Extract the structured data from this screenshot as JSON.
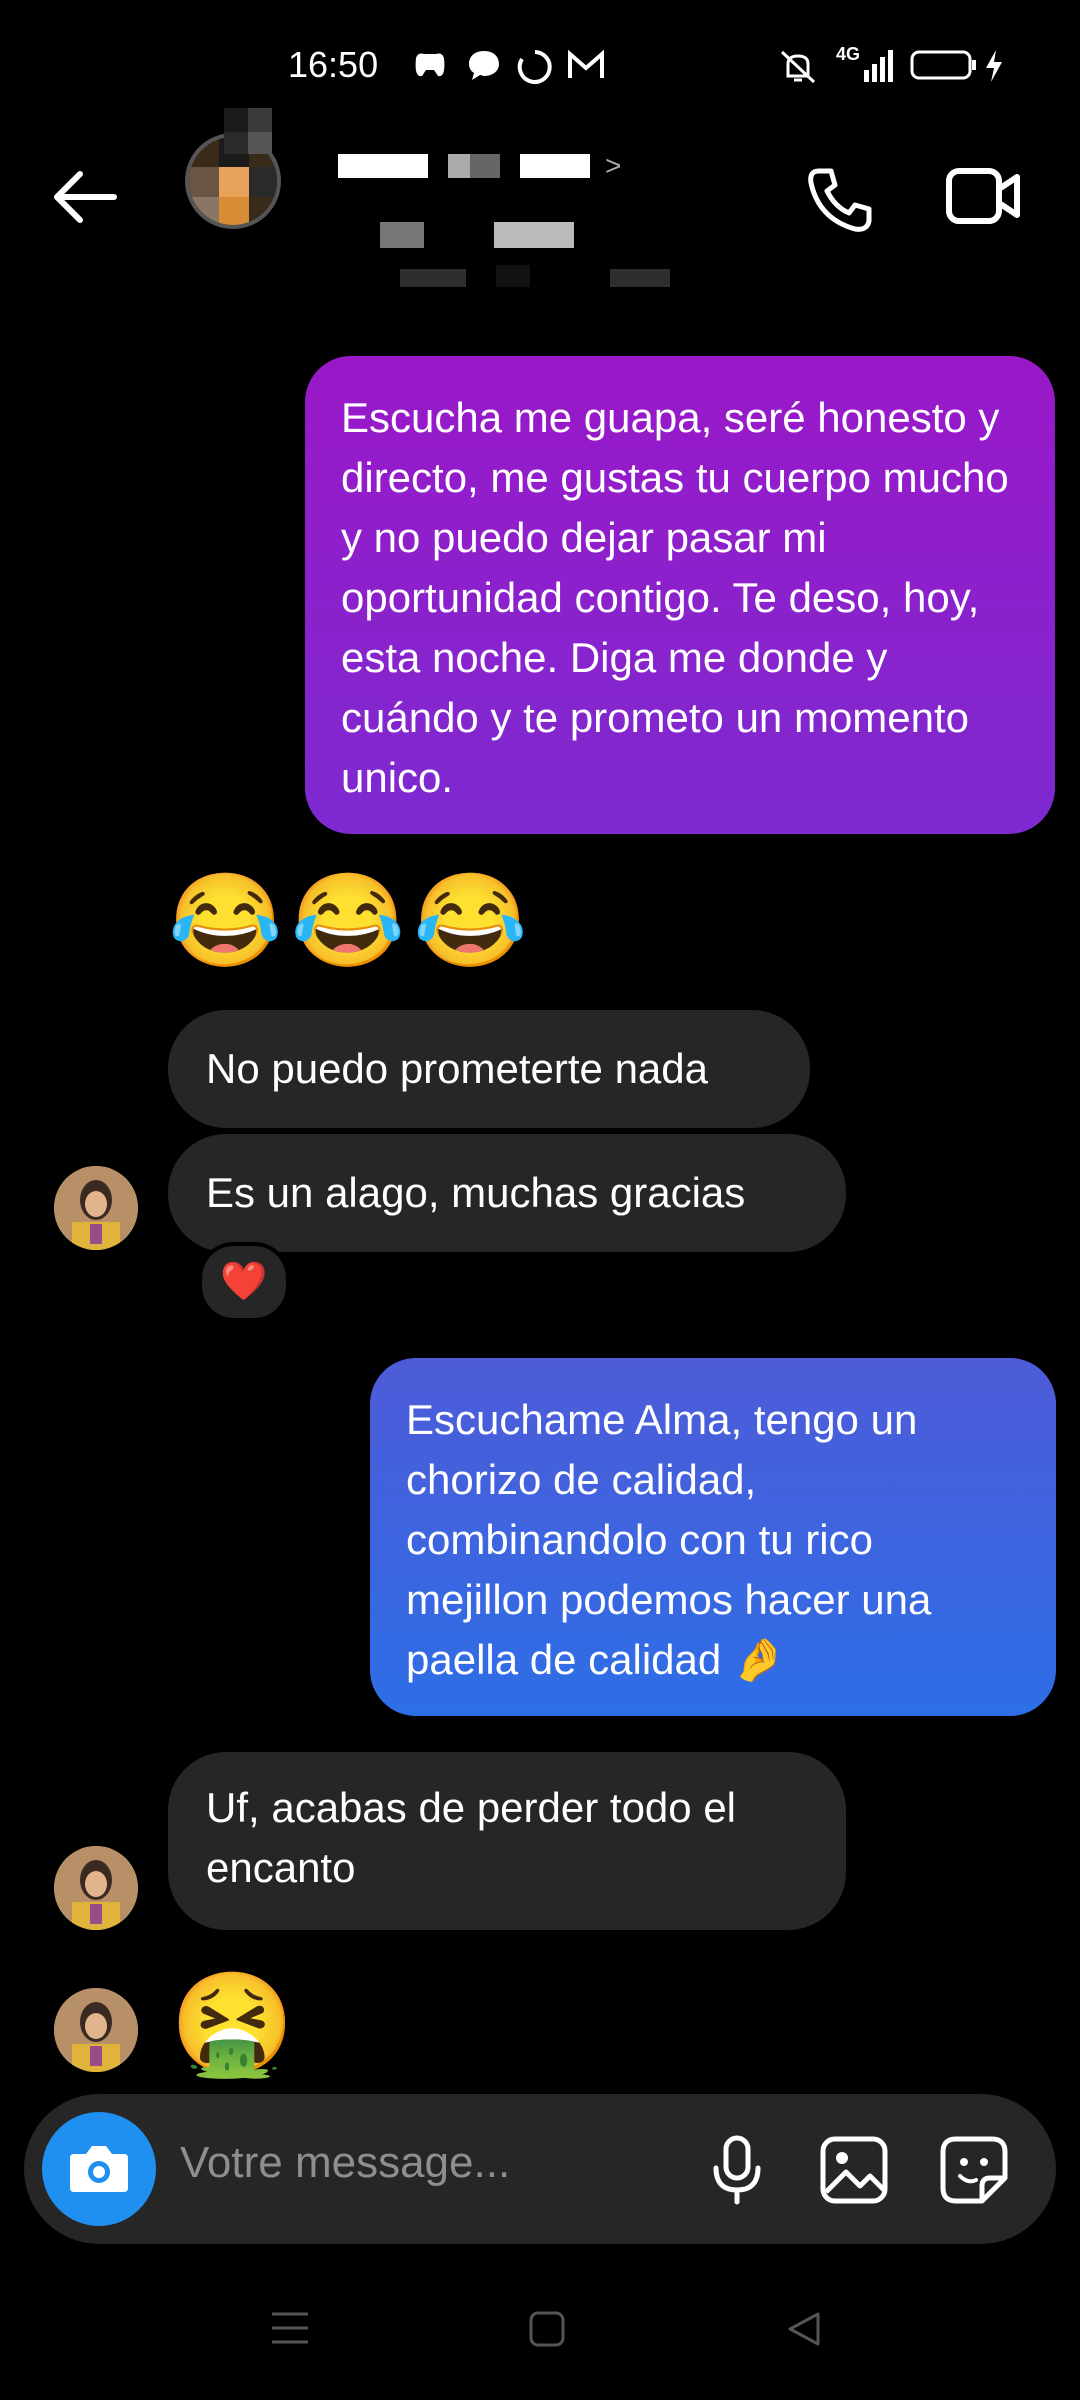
{
  "status_bar": {
    "time": "16:50",
    "network": "4G",
    "icons": [
      "game-controller-icon",
      "chat-bubble-icon",
      "loading-icon",
      "gmail-icon",
      "mute-icon",
      "signal-icon",
      "battery-icon",
      "charging-icon"
    ]
  },
  "header": {
    "chevron": ">",
    "call_icon": "phone-icon",
    "video_icon": "video-camera-icon"
  },
  "messages": {
    "out_1": "Escucha me guapa, seré honesto y directo, me gustas tu cuerpo mucho y no puedo dejar pasar mi oportunidad contigo. Te deso, hoy, esta noche. Diga me donde y cuándo y te prometo un momento unico.",
    "emoji_reply": "😂😂😂",
    "in_1": "No puedo prometerte nada",
    "in_2": "Es un alago, muchas gracias",
    "reaction": "❤️",
    "out_2": "Escuchame Alma, tengo un chorizo de calidad, combinandolo con tu rico mejillon podemos hacer una paella de calidad 🤌",
    "in_3": "Uf, acabas de perder todo el encanto",
    "emoji_final": "🤮"
  },
  "composer": {
    "placeholder": "Votre message..."
  },
  "colors": {
    "outgoing_1": "#8a20cc",
    "outgoing_2": "#3d66e0",
    "incoming": "#262626",
    "camera": "#1f8ff0"
  }
}
